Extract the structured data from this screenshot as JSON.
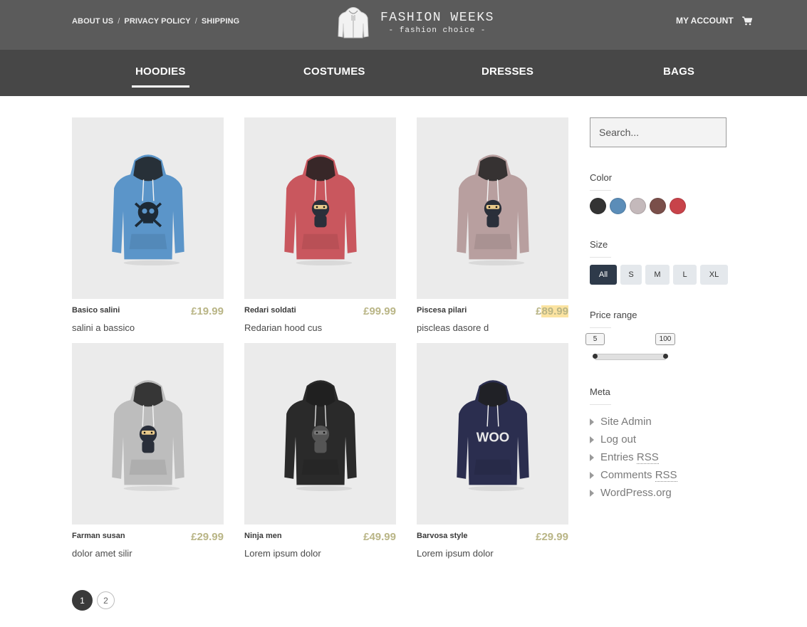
{
  "header": {
    "links": [
      {
        "label": "ABOUT US"
      },
      {
        "label": "PRIVACY POLICY"
      },
      {
        "label": "SHIPPING"
      }
    ],
    "separator": "/",
    "logo_title": "FASHION WEEKS",
    "logo_subtitle": "- fashion choice -",
    "account_label": "MY ACCOUNT",
    "cart_icon": "cart-icon"
  },
  "nav": {
    "categories": [
      {
        "label": "HOODIES",
        "active": true
      },
      {
        "label": "COSTUMES",
        "active": false
      },
      {
        "label": "DRESSES",
        "active": false
      },
      {
        "label": "BAGS",
        "active": false
      }
    ]
  },
  "products": [
    {
      "name": "Basico salini",
      "price": "£19.99",
      "description": "salini a bassico",
      "color": "#5b95c9",
      "print": "skull"
    },
    {
      "name": "Redari soldati",
      "price": "£99.99",
      "description": "Redarian hood cus",
      "color": "#c9575e",
      "print": "ninja"
    },
    {
      "name": "Piscesa pilari",
      "price_prefix": "£",
      "price_highlight": "89.99",
      "description": "piscleas dasore d",
      "color": "#b89f9f",
      "print": "ninja"
    },
    {
      "name": "Farman susan",
      "price": "£29.99",
      "description": "dolor amet silir",
      "color": "#bdbdbd",
      "print": "ninja"
    },
    {
      "name": "Ninja men",
      "price": "£49.99",
      "description": "Lorem ipsum dolor",
      "color": "#2a2a2a",
      "print": "ninja-dark"
    },
    {
      "name": "Barvosa style",
      "price": "£29.99",
      "description": "Lorem ipsum dolor",
      "color": "#2b2e4f",
      "print": "woo"
    }
  ],
  "pagination": {
    "pages": [
      "1",
      "2"
    ],
    "current": "1"
  },
  "sidebar": {
    "search_placeholder": "Search...",
    "color_title": "Color",
    "colors": [
      "#333333",
      "#5b8db8",
      "#c4b9bb",
      "#7a4f4a",
      "#c8434a"
    ],
    "size_title": "Size",
    "sizes": [
      {
        "label": "All",
        "active": true
      },
      {
        "label": "S",
        "active": false
      },
      {
        "label": "M",
        "active": false
      },
      {
        "label": "L",
        "active": false
      },
      {
        "label": "XL",
        "active": false
      }
    ],
    "price_title": "Price range",
    "price_min": "5",
    "price_max": "100",
    "meta_title": "Meta",
    "meta_items": [
      {
        "label": "Site Admin"
      },
      {
        "label": "Log out"
      },
      {
        "label_prefix": "Entries ",
        "label_abbr": "RSS"
      },
      {
        "label_prefix": "Comments ",
        "label_abbr": "RSS"
      },
      {
        "label": "WordPress.org"
      }
    ]
  }
}
